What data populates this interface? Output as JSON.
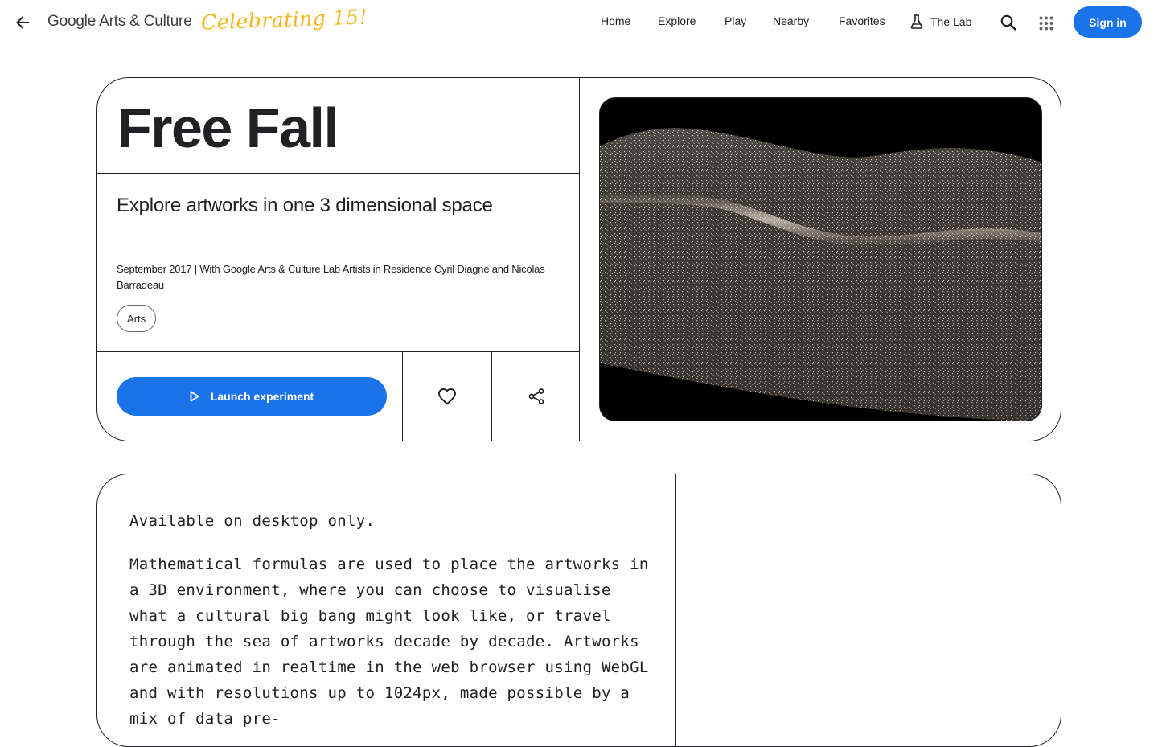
{
  "header": {
    "brand": "Google Arts & Culture",
    "celebrating": "Celebrating 15!",
    "nav": [
      "Home",
      "Explore",
      "Play",
      "Nearby",
      "Favorites",
      "The Lab"
    ],
    "sign_in_label": "Sign in"
  },
  "hero": {
    "title": "Free Fall",
    "subtitle": "Explore artworks in one 3 dimensional space",
    "meta": "September 2017 | With Google Arts & Culture Lab Artists in Residence Cyril Diagne and Nicolas Barradeau",
    "chip": "Arts",
    "launch_label": "Launch experiment"
  },
  "description": {
    "availability": "Available on desktop only.",
    "body": "Mathematical formulas are used to place the artworks in a 3D environment, where you can choose to visualise what a cultural big bang might look like, or travel through the sea of artworks decade by decade. Artworks are animated in realtime in the web browser using WebGL and with resolutions up to 1024px, made possible by a mix of data pre-"
  },
  "icons": {
    "back": "arrow-left-icon",
    "lab": "flask-icon",
    "search": "search-icon",
    "apps": "apps-grid-icon",
    "play": "play-icon",
    "favorite": "heart-icon",
    "share": "share-icon"
  },
  "colors": {
    "accent": "#1a73e8",
    "celebrating": "#f5b718",
    "text": "#202124"
  }
}
